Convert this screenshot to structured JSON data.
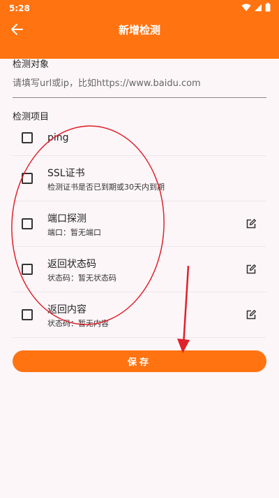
{
  "status_bar": {
    "time": "5:28",
    "icons": [
      "wifi-icon",
      "signal-icon",
      "battery-icon"
    ]
  },
  "header": {
    "title": "新增检测",
    "back_icon": "arrow-left-icon"
  },
  "target": {
    "label": "检测对象",
    "placeholder": "请填写url或ip，比如https://www.baidu.com",
    "value": ""
  },
  "items_section": {
    "label": "检测项目",
    "items": [
      {
        "title": "ping",
        "subtitle": "",
        "checked": false,
        "editable": false
      },
      {
        "title": "SSL证书",
        "subtitle": "检测证书是否已到期或30天内到期",
        "checked": false,
        "editable": false
      },
      {
        "title": "端口探测",
        "subtitle": "端口：暂无端口",
        "checked": false,
        "editable": true
      },
      {
        "title": "返回状态码",
        "subtitle": "状态码：暂无状态码",
        "checked": false,
        "editable": true
      },
      {
        "title": "返回内容",
        "subtitle": "状态码：暂无内容",
        "checked": false,
        "editable": true
      }
    ]
  },
  "actions": {
    "save_label": "保存"
  },
  "colors": {
    "accent": "#ff7311",
    "annotation": "#e0202a",
    "background": "#fdf6f9"
  }
}
